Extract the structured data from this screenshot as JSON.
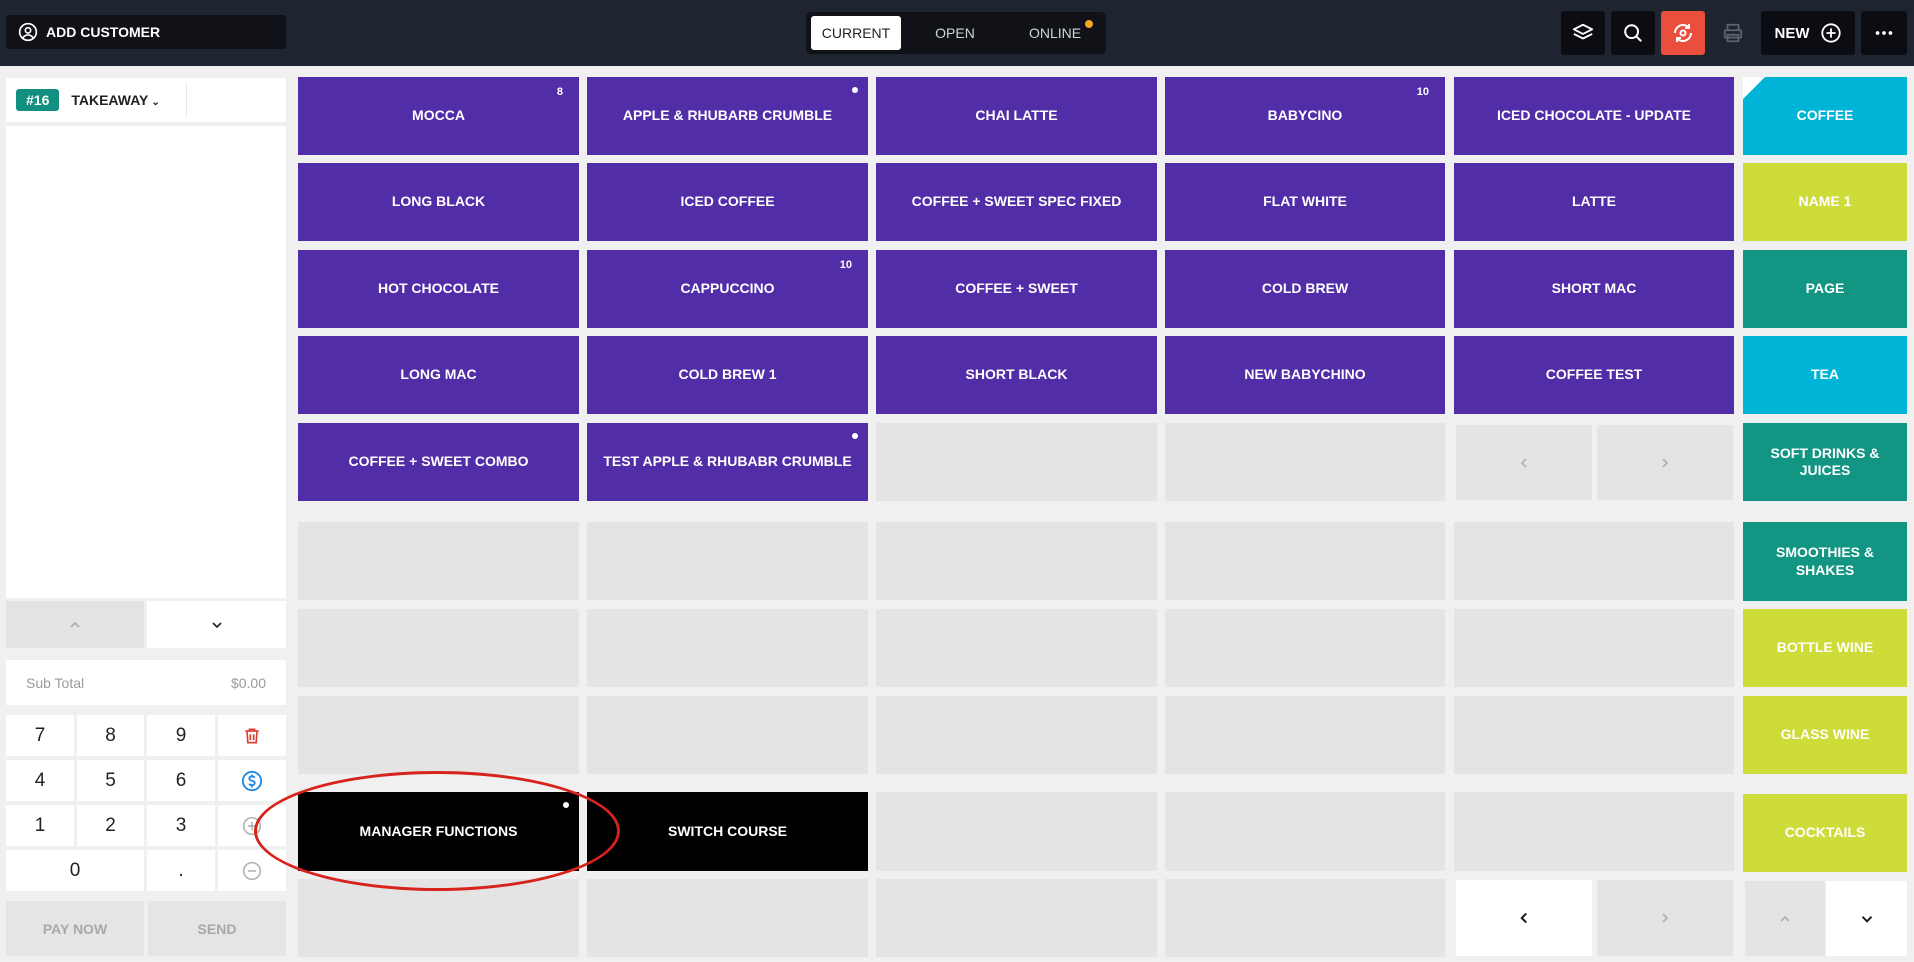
{
  "topbar": {
    "add_customer": "ADD CUSTOMER",
    "tabs": [
      {
        "label": "CURRENT",
        "active": true
      },
      {
        "label": "OPEN",
        "active": false
      },
      {
        "label": "ONLINE",
        "active": false,
        "has_dot": true
      }
    ],
    "icons": [
      "layers-icon",
      "search-icon",
      "sync-icon",
      "printer-icon"
    ],
    "new_label": "NEW",
    "more_icon": "more-horizontal-icon",
    "accent_red": "#ea4e3d",
    "notify_dot": "#f5a623"
  },
  "order": {
    "ticket_number": "#16",
    "order_type": "TAKEAWAY",
    "subtotal_label": "Sub Total",
    "subtotal_value": "$0.00"
  },
  "keypad": {
    "keys": [
      "7",
      "8",
      "9",
      "4",
      "5",
      "6",
      "1",
      "2",
      "3",
      "0",
      "."
    ],
    "pay_now": "PAY NOW",
    "send": "SEND"
  },
  "products": [
    {
      "label": "MOCCA",
      "badge": "8"
    },
    {
      "label": "APPLE & RHUBARB CRUMBLE",
      "dot": true
    },
    {
      "label": "CHAI LATTE"
    },
    {
      "label": "BABYCINO",
      "badge": "10"
    },
    {
      "label": "ICED CHOCOLATE - UPDATE"
    },
    {
      "label": "LONG BLACK"
    },
    {
      "label": "ICED COFFEE"
    },
    {
      "label": "COFFEE + SWEET SPEC FIXED"
    },
    {
      "label": "FLAT WHITE"
    },
    {
      "label": "LATTE"
    },
    {
      "label": "HOT CHOCOLATE"
    },
    {
      "label": "CAPPUCCINO",
      "badge": "10"
    },
    {
      "label": "COFFEE + SWEET"
    },
    {
      "label": "COLD BREW"
    },
    {
      "label": "SHORT MAC"
    },
    {
      "label": "LONG MAC"
    },
    {
      "label": "COLD BREW 1"
    },
    {
      "label": "SHORT BLACK"
    },
    {
      "label": "NEW BABYCHINO"
    },
    {
      "label": "COFFEE TEST"
    },
    {
      "label": "COFFEE + SWEET COMBO"
    },
    {
      "label": "TEST APPLE & RHUBABR CRUMBLE",
      "dot": true
    }
  ],
  "functions": [
    {
      "label": "MANAGER FUNCTIONS",
      "dot": true
    },
    {
      "label": "SWITCH COURSE"
    }
  ],
  "categories": [
    {
      "label": "COFFEE",
      "color": "#00b4d8",
      "selected": true
    },
    {
      "label": "NAME 1",
      "color": "#cddc39"
    },
    {
      "label": "PAGE",
      "color": "#129683"
    },
    {
      "label": "TEA",
      "color": "#00b4d8"
    },
    {
      "label": "SOFT DRINKS & JUICES",
      "color": "#129683"
    },
    {
      "label": "SMOOTHIES & SHAKES",
      "color": "#129683"
    },
    {
      "label": "BOTTLE WINE",
      "color": "#cddc39"
    },
    {
      "label": "GLASS WINE",
      "color": "#cddc39"
    },
    {
      "label": "COCKTAILS",
      "color": "#cddc39"
    }
  ],
  "colors": {
    "product_tile": "#512da8",
    "function_tile": "#000000",
    "empty_tile": "#e4e4e4",
    "ticket_badge": "#128f7e",
    "annotation": "#d6231c"
  }
}
